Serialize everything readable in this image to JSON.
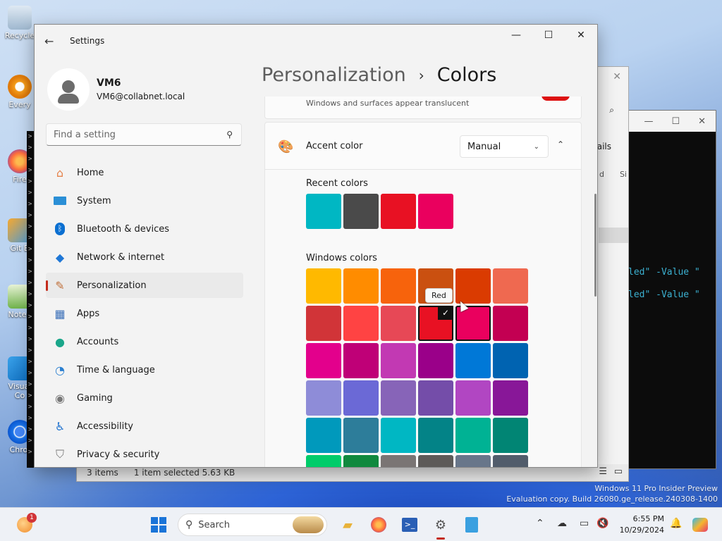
{
  "desktop": {
    "icons": [
      "Recycle",
      "Every",
      "Fire",
      "Git B",
      "Notep",
      "Visual Co",
      "Chrol"
    ],
    "watermark_line1": "Windows 11 Pro Insider Preview",
    "watermark_line2": "Evaluation copy. Build 26080.ge_release.240308-1400"
  },
  "explorer": {
    "items_count": "3 items",
    "selected": "1 item selected  5.63 KB",
    "details_label": "ails",
    "col1": "d",
    "col2": "Si"
  },
  "terminal": {
    "line1": "led\" -Value \"",
    "line2": "led\" -Value \""
  },
  "settings": {
    "window_title": "Settings",
    "user": {
      "name": "VM6",
      "email": "VM6@collabnet.local"
    },
    "search_placeholder": "Find a setting",
    "nav": [
      {
        "label": "Home",
        "icon": "home-icon"
      },
      {
        "label": "System",
        "icon": "monitor-icon"
      },
      {
        "label": "Bluetooth & devices",
        "icon": "bluetooth-icon"
      },
      {
        "label": "Network & internet",
        "icon": "wifi-icon"
      },
      {
        "label": "Personalization",
        "icon": "brush-icon",
        "active": true
      },
      {
        "label": "Apps",
        "icon": "apps-icon"
      },
      {
        "label": "Accounts",
        "icon": "person-icon"
      },
      {
        "label": "Time & language",
        "icon": "globe-clock-icon"
      },
      {
        "label": "Gaming",
        "icon": "gamepad-icon"
      },
      {
        "label": "Accessibility",
        "icon": "accessibility-icon"
      },
      {
        "label": "Privacy & security",
        "icon": "shield-icon"
      }
    ],
    "breadcrumb": {
      "parent": "Personalization",
      "current": "Colors"
    },
    "transparency_desc": "Windows and surfaces appear translucent",
    "accent": {
      "label": "Accent color",
      "mode": "Manual"
    },
    "recent_colors_label": "Recent colors",
    "recent_colors": [
      "#00b7c3",
      "#4a4a4a",
      "#e81123",
      "#ea005e"
    ],
    "windows_colors_label": "Windows colors",
    "windows_colors": [
      [
        "#ffb900",
        "#ff8c00",
        "#f7630c",
        "#ca5010",
        "#da3b01",
        "#ef6950"
      ],
      [
        "#d13438",
        "#ff4343",
        "#e74856",
        "#e81123",
        "#ea005e",
        "#c30052"
      ],
      [
        "#e3008c",
        "#bf0077",
        "#c239b3",
        "#9a0089",
        "#0078d7",
        "#0063b1"
      ],
      [
        "#8e8cd8",
        "#6b69d6",
        "#8764b8",
        "#744da9",
        "#b146c2",
        "#881798"
      ],
      [
        "#0099bc",
        "#2d7d9a",
        "#00b7c3",
        "#038387",
        "#00b294",
        "#018574"
      ],
      [
        "#00cc6a",
        "#10893e",
        "#7a7574",
        "#5d5a58",
        "#68768a",
        "#515c6b"
      ]
    ],
    "tooltip": "Red",
    "check_mark": "✓"
  },
  "taskbar": {
    "search_placeholder": "Search",
    "time": "6:55 PM",
    "date": "10/29/2024",
    "notification_badge": "1"
  }
}
